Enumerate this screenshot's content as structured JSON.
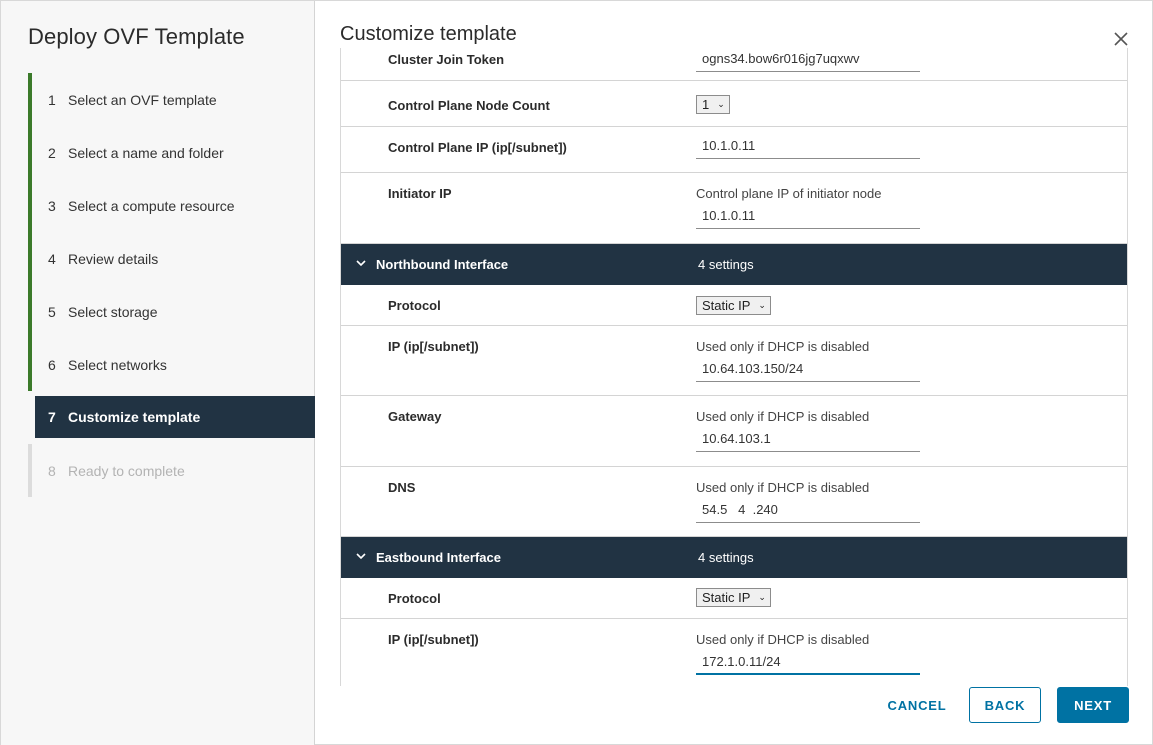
{
  "sidebar": {
    "title": "Deploy OVF Template",
    "steps": [
      {
        "num": "1",
        "label": "Select an OVF template"
      },
      {
        "num": "2",
        "label": "Select a name and folder"
      },
      {
        "num": "3",
        "label": "Select a compute resource"
      },
      {
        "num": "4",
        "label": "Review details"
      },
      {
        "num": "5",
        "label": "Select storage"
      },
      {
        "num": "6",
        "label": "Select networks"
      },
      {
        "num": "7",
        "label": "Customize template"
      },
      {
        "num": "8",
        "label": "Ready to complete"
      }
    ]
  },
  "main": {
    "title": "Customize template",
    "rows": {
      "cluster_join_token": {
        "label": "Cluster Join Token",
        "value": "ogns34.bow6r016jg7uqxwv"
      },
      "control_plane_node_count": {
        "label": "Control Plane Node Count",
        "value": "1"
      },
      "control_plane_ip": {
        "label": "Control Plane IP (ip[/subnet])",
        "value": "10.1.0.11"
      },
      "initiator_ip": {
        "label": "Initiator IP",
        "hint": "Control plane IP of initiator node",
        "value": "10.1.0.11"
      }
    },
    "northbound": {
      "title": "Northbound Interface",
      "count": "4 settings",
      "protocol": {
        "label": "Protocol",
        "value": "Static IP"
      },
      "ip": {
        "label": "IP (ip[/subnet])",
        "hint": "Used only if DHCP is disabled",
        "value": "10.64.103.150/24"
      },
      "gateway": {
        "label": "Gateway",
        "hint": "Used only if DHCP is disabled",
        "value": "10.64.103.1"
      },
      "dns": {
        "label": "DNS",
        "hint": "Used only if DHCP is disabled",
        "value": "54.5   4  .240"
      }
    },
    "eastbound": {
      "title": "Eastbound Interface",
      "count": "4 settings",
      "protocol": {
        "label": "Protocol",
        "value": "Static IP"
      },
      "ip": {
        "label": "IP (ip[/subnet])",
        "hint": "Used only if DHCP is disabled",
        "value": "172.1.0.11/24"
      }
    }
  },
  "footer": {
    "cancel": "CANCEL",
    "back": "BACK",
    "next": "NEXT"
  },
  "colors": {
    "accent": "#0072a3",
    "progress": "#3b7a2a",
    "header_dark": "#213343"
  },
  "icons": {
    "close": "close-icon",
    "chevron": "chevron-down-icon"
  }
}
